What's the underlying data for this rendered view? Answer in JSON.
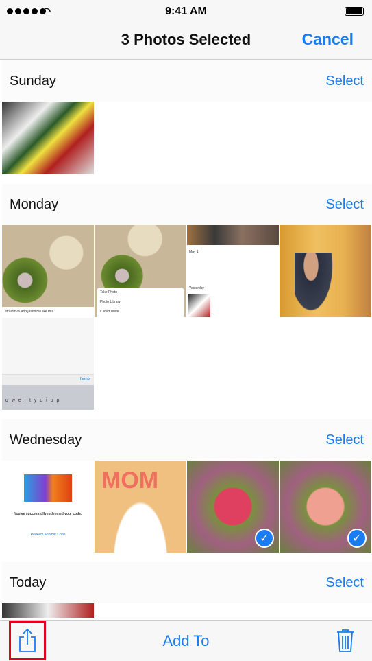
{
  "status": {
    "time": "9:41 AM"
  },
  "nav": {
    "title": "3 Photos Selected",
    "cancel": "Cancel"
  },
  "sections": [
    {
      "title": "Sunday",
      "select": "Select"
    },
    {
      "title": "Monday",
      "select": "Select"
    },
    {
      "title": "Wednesday",
      "select": "Select"
    },
    {
      "title": "Today",
      "select": "Select"
    }
  ],
  "thumbs": {
    "monday_comment": "efrainm26 and jasonlbw like this.",
    "sheet": [
      "Take Photo",
      "Photo Library",
      "iCloud Drive"
    ],
    "may": "May 1",
    "yesterday": "Yesterday",
    "done": "Done",
    "keys": "q w e r t y u i o p",
    "redeem_title": "You've successfully redeemed your code.",
    "redeem_link": "Redeem Another Code"
  },
  "toolbar": {
    "add_to": "Add To",
    "share_icon": "share-icon",
    "trash_icon": "trash-icon"
  },
  "colors": {
    "accent": "#1a7cf2",
    "highlight": "#e0001b"
  }
}
